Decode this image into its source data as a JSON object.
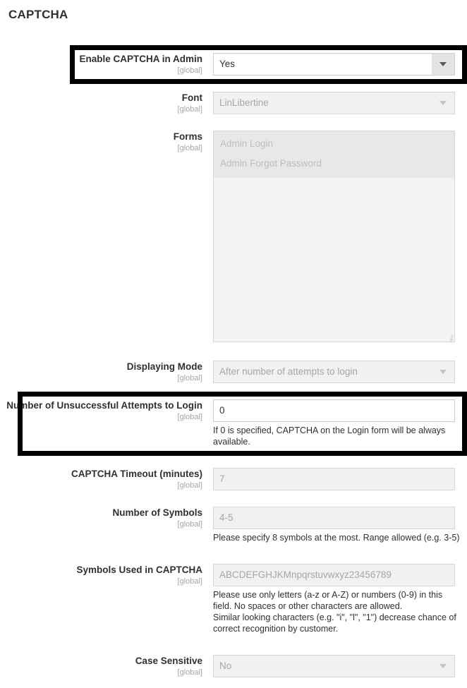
{
  "section": {
    "title": "CAPTCHA"
  },
  "scope_label": "[global]",
  "fields": {
    "enable_captcha": {
      "label": "Enable CAPTCHA in Admin",
      "scope": "[global]",
      "value": "Yes",
      "control": "select",
      "state": "active"
    },
    "font": {
      "label": "Font",
      "scope": "[global]",
      "value": "LinLibertine",
      "control": "select",
      "state": "disabled"
    },
    "forms": {
      "label": "Forms",
      "scope": "[global]",
      "control": "multiselect",
      "state": "disabled",
      "options": [
        "Admin Login",
        "Admin Forgot Password"
      ],
      "selected": [
        "Admin Login",
        "Admin Forgot Password"
      ]
    },
    "displaying_mode": {
      "label": "Displaying Mode",
      "scope": "[global]",
      "value": "After number of attempts to login",
      "control": "select",
      "state": "disabled"
    },
    "attempts": {
      "label": "Number of Unsuccessful Attempts to Login",
      "scope": "[global]",
      "value": "0",
      "control": "text",
      "state": "active",
      "note": "If 0 is specified, CAPTCHA on the Login form will be always available."
    },
    "timeout": {
      "label": "CAPTCHA Timeout (minutes)",
      "scope": "[global]",
      "value": "7",
      "control": "text",
      "state": "disabled"
    },
    "number_of_symbols": {
      "label": "Number of Symbols",
      "scope": "[global]",
      "value": "4-5",
      "control": "text",
      "state": "disabled",
      "note": "Please specify 8 symbols at the most. Range allowed (e.g. 3-5)"
    },
    "symbols_used": {
      "label": "Symbols Used in CAPTCHA",
      "scope": "[global]",
      "value": "ABCDEFGHJKMnpqrstuvwxyz23456789",
      "control": "text",
      "state": "disabled",
      "note_line1": "Please use only letters (a-z or A-Z) or numbers (0-9) in this field. No spaces or other characters are allowed.",
      "note_line2": "Similar looking characters (e.g. \"i\", \"l\", \"1\") decrease chance of correct recognition by customer."
    },
    "case_sensitive": {
      "label": "Case Sensitive",
      "scope": "[global]",
      "value": "No",
      "control": "select",
      "state": "disabled"
    }
  },
  "annotations": {
    "highlight_1_target": "Enable CAPTCHA in Admin",
    "highlight_2_target": "Number of Unsuccessful Attempts to Login",
    "highlight_color": "#000000"
  },
  "icons": {
    "dropdown": "chevron-down-icon",
    "resize": "resize-handle-icon"
  }
}
